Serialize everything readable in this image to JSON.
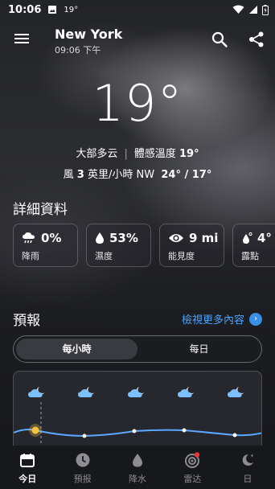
{
  "status_bar": {
    "time": "10:06",
    "temp": "19°"
  },
  "header": {
    "city": "New York",
    "local_time": "09:06 下午"
  },
  "current": {
    "temperature": "19°",
    "condition": "大部多云",
    "feels_like_label": "體感溫度",
    "feels_like_value": "19°",
    "wind_prefix": "風",
    "wind_speed": "3",
    "wind_unit": "英里/小時",
    "wind_dir": "NW",
    "high_low": "24° / 17°"
  },
  "details": {
    "title": "詳細資料",
    "items": [
      {
        "value": "0%",
        "label": "降雨",
        "icon": "rain-cloud-icon"
      },
      {
        "value": "53%",
        "label": "濕度",
        "icon": "humidity-drop-icon"
      },
      {
        "value": "9 mi",
        "label": "能見度",
        "icon": "eye-icon"
      },
      {
        "value": "4°",
        "label": "露點",
        "icon": "dew-point-icon"
      }
    ]
  },
  "forecast": {
    "title": "預報",
    "more_label": "檢視更多內容",
    "tabs": [
      "每小時",
      "每日"
    ],
    "active_tab": 0,
    "hourly_icons": [
      "partly-cloudy-night-icon",
      "partly-cloudy-night-icon",
      "partly-cloudy-night-icon",
      "partly-cloudy-night-icon",
      "partly-cloudy-night-icon"
    ]
  },
  "nav": {
    "items": [
      {
        "label": "今日",
        "icon": "calendar-icon"
      },
      {
        "label": "預报",
        "icon": "clock-icon"
      },
      {
        "label": "降水",
        "icon": "drop-icon"
      },
      {
        "label": "雷达",
        "icon": "radar-icon"
      },
      {
        "label": "日",
        "icon": "moon-sun-icon"
      }
    ],
    "active": 0
  },
  "colors": {
    "accent": "#4aa3ff",
    "sun": "#f5c242",
    "alert": "#e53935"
  }
}
